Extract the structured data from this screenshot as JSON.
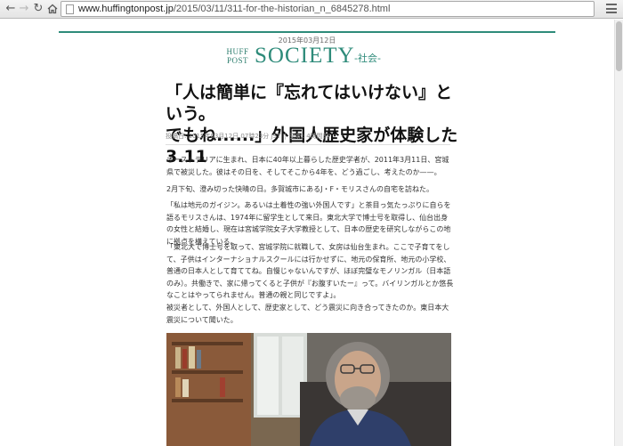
{
  "browser": {
    "url_domain": "www.huffingtonpost.jp",
    "url_path": "/2015/03/11/311-for-the-historian_n_6845278.html",
    "icons": [
      "back-arrow-icon",
      "forward-arrow-icon",
      "reload-icon",
      "home-icon",
      "page-icon",
      "star-icon",
      "menu-icon"
    ]
  },
  "masthead": {
    "edition_date": "2015年03月12日",
    "brand_line1": "HUFF",
    "brand_line2": "POST",
    "section": "SOCIETY",
    "section_sub": "-社会-",
    "accent_color": "#2e8b7a"
  },
  "article": {
    "headline_line1": "「人は簡単に『忘れてはいけない』という。",
    "headline_line2": "でもね......」外国人歴史家が体験した3.11",
    "posted": "投稿日: 2015年03月12日 07時23分 JST",
    "updated": "更新: 4時間前",
    "paragraphs": [
      "オーストラリアに生まれ、日本に40年以上暮らした歴史学者が、2011年3月11日、宮城県で被災した。彼はその日を、そしてそこから4年を、どう過ごし、考えたのか——。",
      "2月下旬、澄み切った快晴の日。多賀城市にあるJ・F・モリスさんの自宅を訪ねた。",
      "「私は地元のガイジン。あるいは土着性の強い外国人です」と茶目っ気たっぷりに自らを語るモリスさんは、1974年に留学生として来日。東北大学で博士号を取得し、仙台出身の女性と結婚し、現在は宮城学院女子大学教授として、日本の歴史を研究しながらこの地に拠点を構えている。",
      "「東北大で博士号を取って、宮城学院に就職して、女房は仙台生まれ。ここで子育てをして、子供はインターナショナルスクールには行かせずに、地元の保育所、地元の小学校、普通の日本人として育ててね。自慢じゃないんですが、ほぼ完璧なモノリンガル（日本語のみ）。共働きで、家に帰ってくると子供が『お腹すいたー』って。バイリンガルとか悠長なことはやってられません。普通の親と同じですよ」。",
      "被災者として、外国人として、歴史家として、どう震災に向き合ってきたのか。東日本大震災について聞いた。"
    ]
  }
}
